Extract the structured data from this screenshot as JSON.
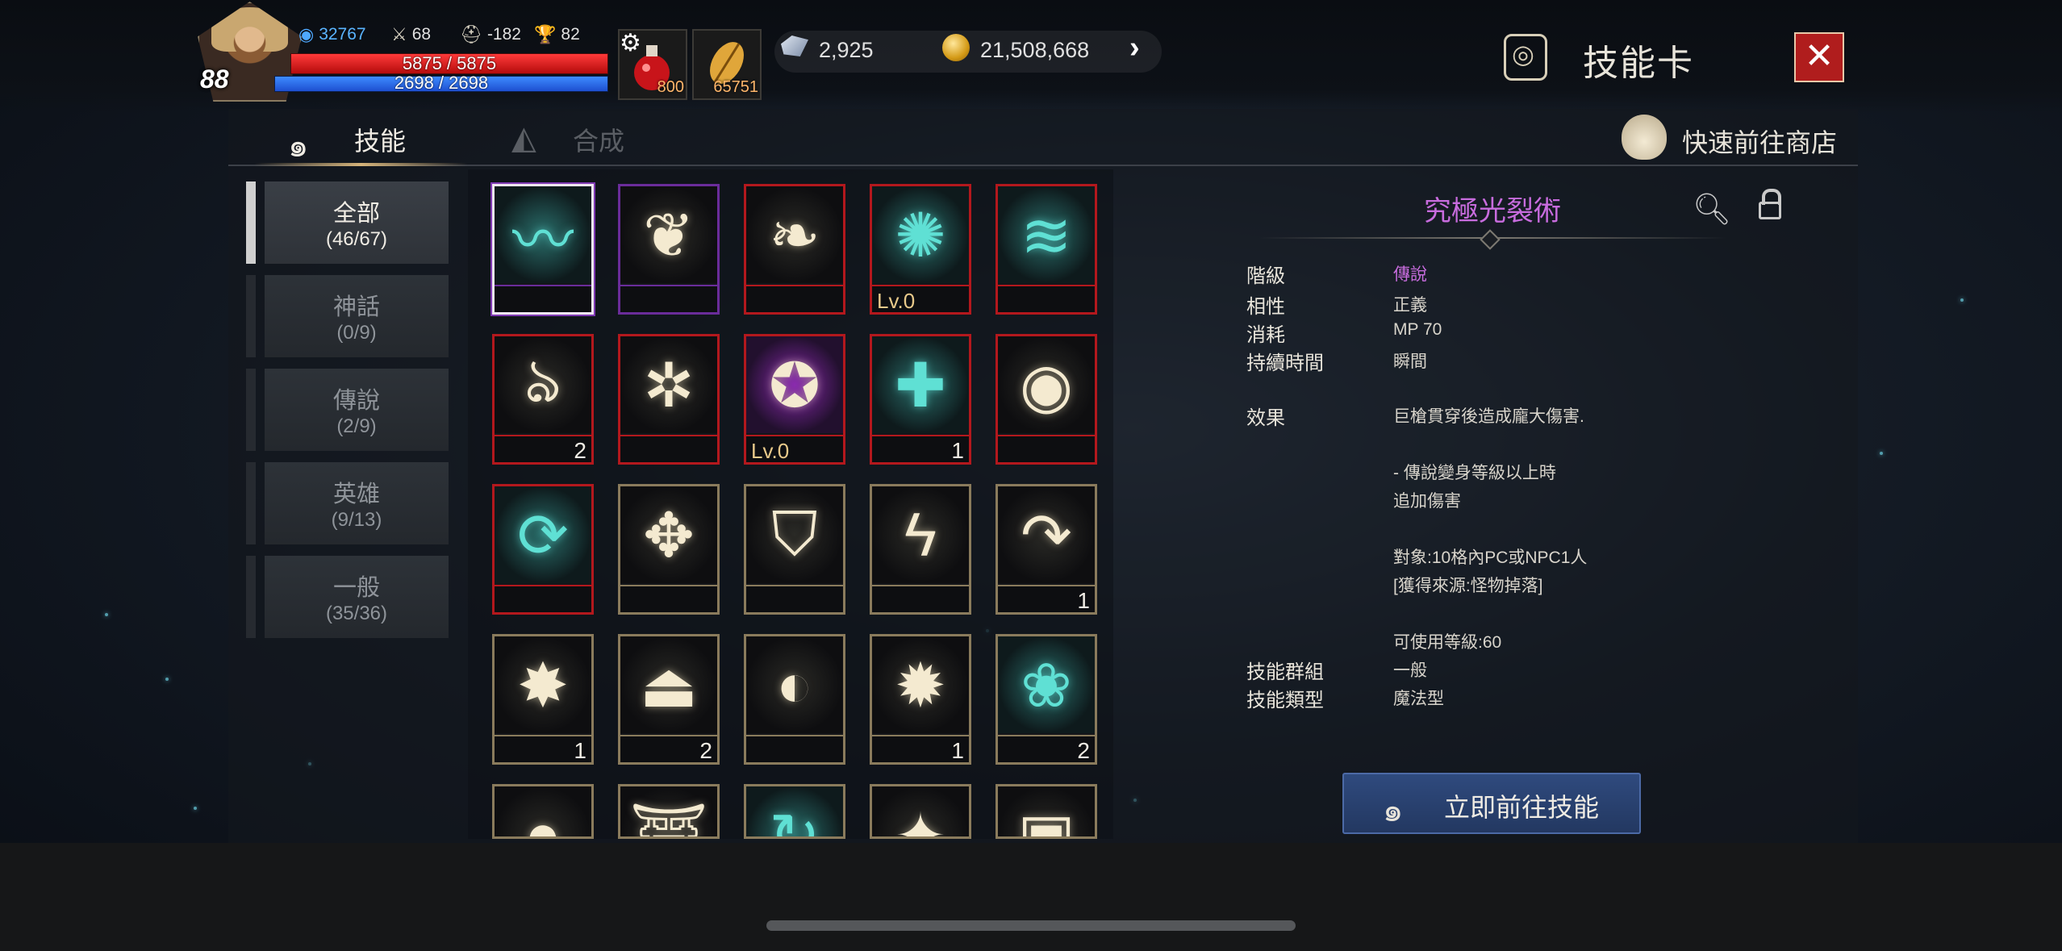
{
  "player": {
    "level": "88",
    "mana_crystals": "32767",
    "stat_attack": "68",
    "stat_defense": "-182",
    "stat_trophy": "82",
    "hp": "5875 / 5875",
    "mp": "2698 / 2698"
  },
  "quick_slots": [
    {
      "icon": "health-potion",
      "count": "800"
    },
    {
      "icon": "golden-leaf",
      "count": "65751"
    }
  ],
  "currency": {
    "crystal": "2,925",
    "gold": "21,508,668"
  },
  "window": {
    "title": "技能卡"
  },
  "tabs": [
    {
      "label": "技能",
      "active": true
    },
    {
      "label": "合成",
      "active": false
    }
  ],
  "shop_link": "快速前往商店",
  "categories": [
    {
      "name": "全部",
      "count": "(46/67)"
    },
    {
      "name": "神話",
      "count": "(0/9)"
    },
    {
      "name": "傳說",
      "count": "(2/9)"
    },
    {
      "name": "英雄",
      "count": "(9/13)"
    },
    {
      "name": "一般",
      "count": "(35/36)"
    }
  ],
  "skills": [
    {
      "icon": "teal-claw-slash",
      "tier": "purple",
      "count": "",
      "lvl": ""
    },
    {
      "icon": "cream-swirl-heart",
      "tier": "purple",
      "count": "",
      "lvl": ""
    },
    {
      "icon": "cream-wings-stars",
      "tier": "red",
      "count": "",
      "lvl": ""
    },
    {
      "icon": "teal-crest-emblem",
      "tier": "red",
      "count": "",
      "lvl": "Lv.0"
    },
    {
      "icon": "teal-wind-streaks",
      "tier": "red",
      "count": "",
      "lvl": ""
    },
    {
      "icon": "cream-flame-drop",
      "tier": "red",
      "count": "2",
      "lvl": ""
    },
    {
      "icon": "cream-vortex",
      "tier": "red",
      "count": "",
      "lvl": ""
    },
    {
      "icon": "purple-demon-star",
      "tier": "red",
      "count": "",
      "lvl": "Lv.0"
    },
    {
      "icon": "teal-plus-cross",
      "tier": "red",
      "count": "1",
      "lvl": ""
    },
    {
      "icon": "cream-eye-arrow",
      "tier": "red",
      "count": "",
      "lvl": ""
    },
    {
      "icon": "teal-rotate-seal",
      "tier": "red",
      "count": "",
      "lvl": ""
    },
    {
      "icon": "cream-mask",
      "tier": "gold",
      "count": "",
      "lvl": ""
    },
    {
      "icon": "cream-shield",
      "tier": "gold",
      "count": "",
      "lvl": ""
    },
    {
      "icon": "cream-lightning",
      "tier": "gold",
      "count": "",
      "lvl": ""
    },
    {
      "icon": "cream-curved-arrow",
      "tier": "gold",
      "count": "1",
      "lvl": ""
    },
    {
      "icon": "cream-burst",
      "tier": "gold",
      "count": "1",
      "lvl": ""
    },
    {
      "icon": "cream-weight",
      "tier": "gold",
      "count": "2",
      "lvl": ""
    },
    {
      "icon": "cream-glare-eye",
      "tier": "gold",
      "count": "",
      "lvl": ""
    },
    {
      "icon": "cream-thorn-ring",
      "tier": "gold",
      "count": "1",
      "lvl": ""
    },
    {
      "icon": "teal-leaf-slash",
      "tier": "gold",
      "count": "2",
      "lvl": ""
    },
    {
      "icon": "cream-orb",
      "tier": "gold",
      "count": "",
      "lvl": ""
    },
    {
      "icon": "cream-temple",
      "tier": "gold",
      "count": "",
      "lvl": ""
    },
    {
      "icon": "teal-arc-arrow",
      "tier": "gold",
      "count": "",
      "lvl": ""
    },
    {
      "icon": "cream-sparkles",
      "tier": "gold",
      "count": "",
      "lvl": ""
    },
    {
      "icon": "cream-rune-box",
      "tier": "gold",
      "count": "",
      "lvl": ""
    }
  ],
  "detail": {
    "title": "究極光裂術",
    "rows": [
      {
        "label": "階級",
        "value": "傳說"
      },
      {
        "label": "相性",
        "value": "正義"
      },
      {
        "label": "消耗",
        "value": "MP 70"
      },
      {
        "label": "持續時間",
        "value": "瞬間"
      },
      {
        "label": "效果",
        "value": "巨槍貫穿後造成龐大傷害."
      },
      {
        "label": "",
        "value": "- 傳說變身等級以上時"
      },
      {
        "label": "",
        "value": "追加傷害"
      },
      {
        "label": "",
        "value": "對象:10格內PC或NPC1人"
      },
      {
        "label": "",
        "value": "[獲得來源:怪物掉落]"
      },
      {
        "label": "",
        "value": "可使用等級:60"
      },
      {
        "label": "技能群組",
        "value": "一般"
      },
      {
        "label": "技能類型",
        "value": "魔法型"
      }
    ]
  },
  "go_button": "立即前往技能",
  "colors": {
    "legendary": "#c86cde",
    "hp": "#e02020",
    "mp": "#2f6cf0",
    "close": "#b01d1d"
  }
}
